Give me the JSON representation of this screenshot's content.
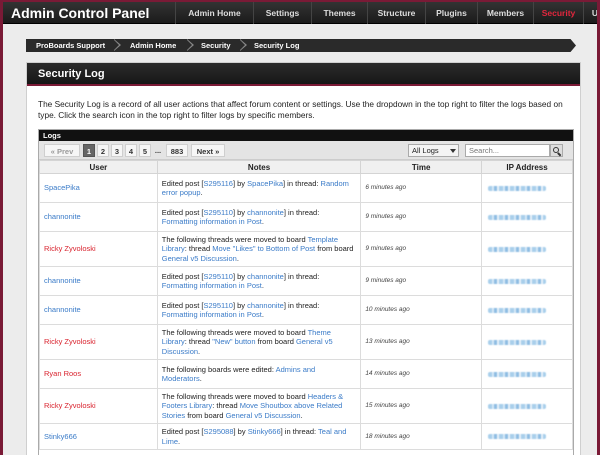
{
  "header": {
    "title": "Admin Control Panel"
  },
  "nav": [
    {
      "label": "Admin Home",
      "active": false
    },
    {
      "label": "Settings",
      "active": false
    },
    {
      "label": "Themes",
      "active": false
    },
    {
      "label": "Structure",
      "active": false
    },
    {
      "label": "Plugins",
      "active": false
    },
    {
      "label": "Members",
      "active": false
    },
    {
      "label": "Security",
      "active": true
    },
    {
      "label": "Upgrades",
      "active": false
    }
  ],
  "breadcrumb": [
    "ProBoards Support",
    "Admin Home",
    "Security",
    "Security Log"
  ],
  "panel": {
    "title": "Security Log",
    "description": "The Security Log is a record of all user actions that affect forum content or settings. Use the dropdown in the top right to filter the logs based on type. Click the search icon in the top right to filter logs by specific members."
  },
  "logs": {
    "heading": "Logs",
    "pagination": {
      "prev": "« Prev",
      "pages": [
        "1",
        "2",
        "3",
        "4",
        "5"
      ],
      "ellipsis": "...",
      "last": "883",
      "next": "Next »",
      "current": "1"
    },
    "filter": {
      "selected": "All Logs"
    },
    "search": {
      "placeholder": "Search..."
    },
    "columns": {
      "user": "User",
      "notes": "Notes",
      "time": "Time",
      "ip": "IP Address"
    },
    "rows": [
      {
        "user": "SpacePika",
        "user_color": "blue",
        "time": "6 minutes ago",
        "notes": [
          {
            "t": "Edited post ["
          },
          {
            "t": "S295116",
            "l": 1
          },
          {
            "t": "] by "
          },
          {
            "t": "SpacePika",
            "l": 1
          },
          {
            "t": "] in thread: "
          },
          {
            "t": "Random error popup",
            "l": 1
          },
          {
            "t": "."
          }
        ]
      },
      {
        "user": "channonite",
        "user_color": "blue",
        "time": "9 minutes ago",
        "notes": [
          {
            "t": "Edited post ["
          },
          {
            "t": "S295110",
            "l": 1
          },
          {
            "t": "] by "
          },
          {
            "t": "channonite",
            "l": 1
          },
          {
            "t": "] in thread: "
          },
          {
            "t": "Formatting information in Post",
            "l": 1
          },
          {
            "t": "."
          }
        ]
      },
      {
        "user": "Ricky Zyvoloski",
        "user_color": "red",
        "time": "9 minutes ago",
        "notes": [
          {
            "t": "The following threads were moved to board "
          },
          {
            "t": "Template Library",
            "l": 1
          },
          {
            "t": ": thread "
          },
          {
            "t": "Move \"Likes\" to Bottom of Post",
            "l": 1
          },
          {
            "t": " from board "
          },
          {
            "t": "General v5 Discussion",
            "l": 1
          },
          {
            "t": "."
          }
        ]
      },
      {
        "user": "channonite",
        "user_color": "blue",
        "time": "9 minutes ago",
        "notes": [
          {
            "t": "Edited post ["
          },
          {
            "t": "S295110",
            "l": 1
          },
          {
            "t": "] by "
          },
          {
            "t": "channonite",
            "l": 1
          },
          {
            "t": "] in thread: "
          },
          {
            "t": "Formatting information in Post",
            "l": 1
          },
          {
            "t": "."
          }
        ]
      },
      {
        "user": "channonite",
        "user_color": "blue",
        "time": "10 minutes ago",
        "notes": [
          {
            "t": "Edited post ["
          },
          {
            "t": "S295110",
            "l": 1
          },
          {
            "t": "] by "
          },
          {
            "t": "channonite",
            "l": 1
          },
          {
            "t": "] in thread: "
          },
          {
            "t": "Formatting information in Post",
            "l": 1
          },
          {
            "t": "."
          }
        ]
      },
      {
        "user": "Ricky Zyvoloski",
        "user_color": "red",
        "time": "13 minutes ago",
        "notes": [
          {
            "t": "The following threads were moved to board "
          },
          {
            "t": "Theme Library",
            "l": 1
          },
          {
            "t": ": thread "
          },
          {
            "t": "\"New\" button",
            "l": 1
          },
          {
            "t": " from board "
          },
          {
            "t": "General v5 Discussion",
            "l": 1
          },
          {
            "t": "."
          }
        ]
      },
      {
        "user": "Ryan Roos",
        "user_color": "red",
        "time": "14 minutes ago",
        "notes": [
          {
            "t": "The following boards were edited: "
          },
          {
            "t": "Admins and Moderators",
            "l": 1
          },
          {
            "t": "."
          }
        ]
      },
      {
        "user": "Ricky Zyvoloski",
        "user_color": "red",
        "time": "15 minutes ago",
        "notes": [
          {
            "t": "The following threads were moved to board "
          },
          {
            "t": "Headers & Footers Library",
            "l": 1
          },
          {
            "t": ": thread "
          },
          {
            "t": "Move Shoutbox above Related Stories",
            "l": 1
          },
          {
            "t": " from board "
          },
          {
            "t": "General v5 Discussion",
            "l": 1
          },
          {
            "t": "."
          }
        ]
      },
      {
        "user": "Stinky666",
        "user_color": "blue",
        "time": "18 minutes ago",
        "notes": [
          {
            "t": "Edited post ["
          },
          {
            "t": "S295088",
            "l": 1
          },
          {
            "t": "] by "
          },
          {
            "t": "Stinky666",
            "l": 1
          },
          {
            "t": "] in thread: "
          },
          {
            "t": "Teal and Lime",
            "l": 1
          },
          {
            "t": "."
          }
        ]
      }
    ]
  },
  "colors": {
    "accent": "#7a1a36",
    "active_nav": "#e2263d",
    "link": "#3a7bc8",
    "staff_name": "#d9232e"
  }
}
